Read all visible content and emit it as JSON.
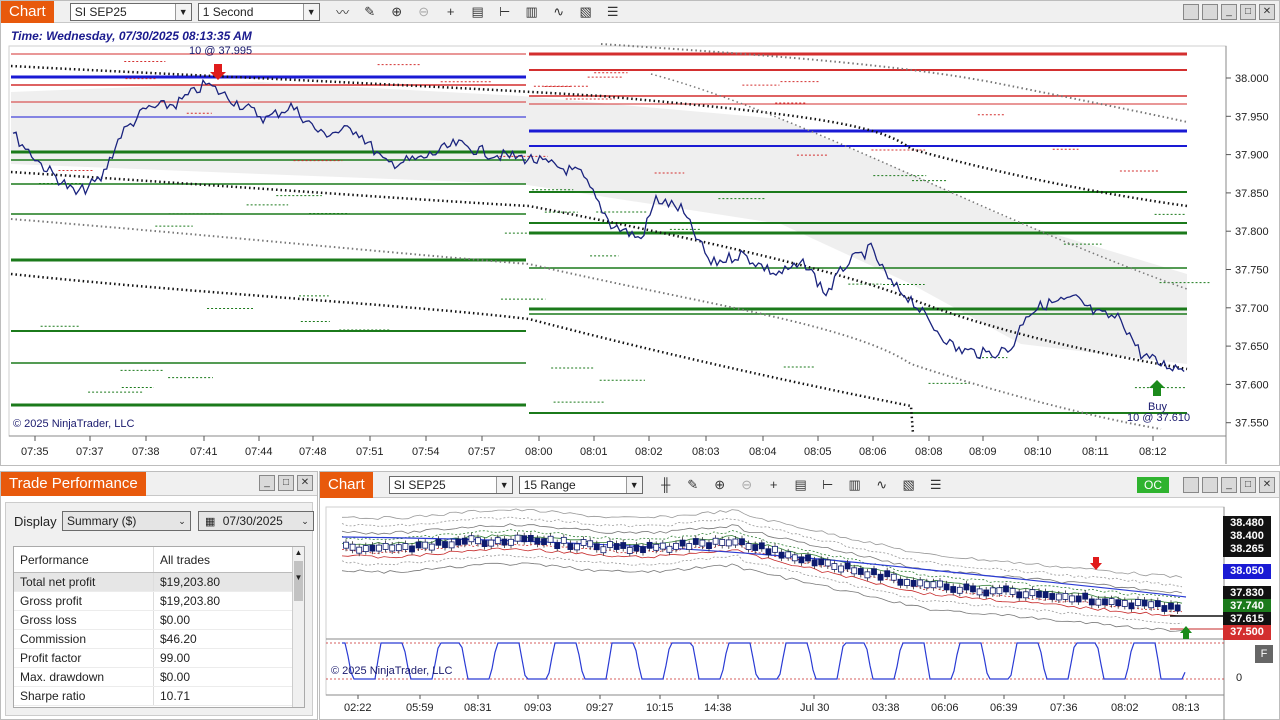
{
  "top_chart": {
    "tab_label": "Chart",
    "instrument": "SI SEP25",
    "interval": "1 Second",
    "time_header": "Time: Wednesday, 07/30/2025 08:13:35 AM",
    "copyright": "© 2025 NinjaTrader, LLC",
    "sell_annotation": "10 @ 37.995",
    "buy_label": "Buy",
    "buy_annotation": "10 @ 37.610",
    "y_ticks": [
      "38.000",
      "37.950",
      "37.900",
      "37.850",
      "37.800",
      "37.750",
      "37.700",
      "37.650",
      "37.600",
      "37.550"
    ],
    "x_ticks": [
      "07:35",
      "07:37",
      "07:38",
      "07:41",
      "07:44",
      "07:48",
      "07:51",
      "07:54",
      "07:57",
      "08:00",
      "08:01",
      "08:02",
      "08:03",
      "08:04",
      "08:05",
      "08:06",
      "08:08",
      "08:09",
      "08:10",
      "08:11",
      "08:12"
    ],
    "colors": {
      "price_line": "#1a237e",
      "resistance": "#d32f2f",
      "support": "#1b7a1b",
      "level_blue": "#1a1ad4"
    }
  },
  "trade_performance": {
    "title": "Trade Performance",
    "display_label": "Display",
    "display_value": "Summary ($)",
    "date_value": "07/30/2025",
    "header": [
      "Performance",
      "All trades"
    ],
    "rows": [
      [
        "Total net profit",
        "$19,203.80"
      ],
      [
        "Gross profit",
        "$19,203.80"
      ],
      [
        "Gross loss",
        "$0.00"
      ],
      [
        "Commission",
        "$46.20"
      ],
      [
        "Profit factor",
        "99.00"
      ],
      [
        "Max. drawdown",
        "$0.00"
      ],
      [
        "Sharpe ratio",
        "10.71"
      ]
    ]
  },
  "bottom_chart": {
    "tab_label": "Chart",
    "instrument": "SI SEP25",
    "interval": "15 Range",
    "oc_badge": "OC",
    "copyright": "© 2025 NinjaTrader, LLC",
    "x_ticks": [
      "02:22",
      "05:59",
      "08:31",
      "09:03",
      "09:27",
      "10:15",
      "14:38",
      "Jul 30",
      "03:38",
      "06:06",
      "06:39",
      "07:36",
      "08:02",
      "08:13"
    ],
    "price_tags": [
      {
        "value": "38.480",
        "color": "#111111"
      },
      {
        "value": "38.400",
        "color": "#111111"
      },
      {
        "value": "38.265",
        "color": "#111111"
      },
      {
        "value": "38.050",
        "color": "#1a1ad4"
      },
      {
        "value": "37.830",
        "color": "#111111"
      },
      {
        "value": "37.740",
        "color": "#1b7a1b"
      },
      {
        "value": "37.615",
        "color": "#111111"
      },
      {
        "value": "37.500",
        "color": "#d32f2f"
      }
    ],
    "indicator_zero": "0",
    "f_badge": "F"
  }
}
